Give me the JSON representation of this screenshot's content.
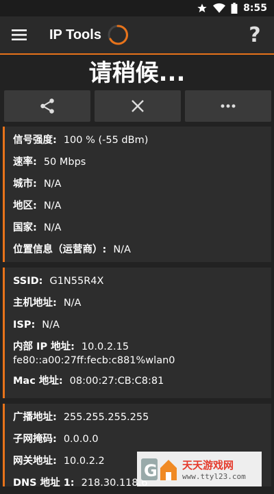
{
  "status_bar": {
    "time": "8:55"
  },
  "app_bar": {
    "title": "IP Tools",
    "help": "?"
  },
  "heading": "请稍候...",
  "card1": [
    {
      "key": "信号强度:",
      "value": "100 % (-55 dBm)"
    },
    {
      "key": "速率:",
      "value": "50 Mbps"
    },
    {
      "key": "城市:",
      "value": "N/A"
    },
    {
      "key": "地区:",
      "value": "N/A"
    },
    {
      "key": "国家:",
      "value": "N/A"
    },
    {
      "key": "位置信息（运营商）:",
      "value": "N/A"
    }
  ],
  "card2": {
    "ssid": {
      "key": "SSID:",
      "value": "G1N55R4X"
    },
    "host": {
      "key": "主机地址:",
      "value": "N/A"
    },
    "isp": {
      "key": "ISP:",
      "value": "N/A"
    },
    "internal_ip": {
      "key": "内部 IP 地址:",
      "value": "10.0.2.15",
      "value2": "fe80::a00:27ff:fecb:c881%wlan0"
    },
    "mac": {
      "key": "Mac 地址:",
      "value": "08:00:27:CB:C8:81"
    }
  },
  "card3": [
    {
      "key": "广播地址:",
      "value": "255.255.255.255"
    },
    {
      "key": "子网掩码:",
      "value": "0.0.0.0"
    },
    {
      "key": "网关地址:",
      "value": "10.0.2.2"
    },
    {
      "key": "DNS 地址 1:",
      "value": "218.30.118.6"
    }
  ],
  "watermark": {
    "name": "天天游戏网",
    "url": "www.ttyl23.com"
  },
  "colors": {
    "accent": "#e8731a",
    "background": "#222222",
    "card": "#2d2d2d"
  }
}
